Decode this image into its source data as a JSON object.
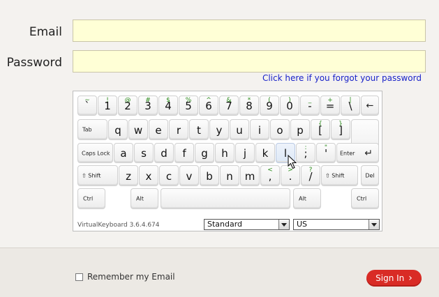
{
  "form": {
    "email_label": "Email",
    "email_value": "",
    "password_label": "Password",
    "password_value": "",
    "forgot_link": "Click here if you forgot your password"
  },
  "keyboard": {
    "version": "VirtualKeyboard 3.6.4.674",
    "layout_select": "Standard",
    "language_select": "US",
    "keys": {
      "backquote": {
        "main": "`",
        "shift": "~"
      },
      "1": {
        "main": "1",
        "shift": "!"
      },
      "2": {
        "main": "2",
        "shift": "@"
      },
      "3": {
        "main": "3",
        "shift": "#"
      },
      "4": {
        "main": "4",
        "shift": "$"
      },
      "5": {
        "main": "5",
        "shift": "%"
      },
      "6": {
        "main": "6",
        "shift": "^"
      },
      "7": {
        "main": "7",
        "shift": "&"
      },
      "8": {
        "main": "8",
        "shift": "*"
      },
      "9": {
        "main": "9",
        "shift": "("
      },
      "0": {
        "main": "0",
        "shift": ")"
      },
      "minus": {
        "main": "-",
        "shift": "_"
      },
      "equal": {
        "main": "=",
        "shift": "+"
      },
      "backslash": {
        "main": "\\",
        "shift": "|"
      },
      "backspace": {
        "main": "←"
      },
      "tab": {
        "main": "Tab"
      },
      "q": {
        "main": "q"
      },
      "w": {
        "main": "w"
      },
      "e": {
        "main": "e"
      },
      "r": {
        "main": "r"
      },
      "t": {
        "main": "t"
      },
      "y": {
        "main": "y"
      },
      "u": {
        "main": "u"
      },
      "i": {
        "main": "i"
      },
      "o": {
        "main": "o"
      },
      "p": {
        "main": "p"
      },
      "lbracket": {
        "main": "[",
        "shift": "{"
      },
      "rbracket": {
        "main": "]",
        "shift": "}"
      },
      "capslock": {
        "main": "Caps Lock"
      },
      "a": {
        "main": "a"
      },
      "s": {
        "main": "s"
      },
      "d": {
        "main": "d"
      },
      "f": {
        "main": "f"
      },
      "g": {
        "main": "g"
      },
      "h": {
        "main": "h"
      },
      "j": {
        "main": "j"
      },
      "k": {
        "main": "k"
      },
      "l": {
        "main": "l"
      },
      "semicolon": {
        "main": ";",
        "shift": ":"
      },
      "quote": {
        "main": "'",
        "shift": "\""
      },
      "enter": {
        "main": "Enter",
        "arrow": "↵"
      },
      "lshift": {
        "main": "⇧ Shift"
      },
      "z": {
        "main": "z"
      },
      "x": {
        "main": "x"
      },
      "c": {
        "main": "c"
      },
      "v": {
        "main": "v"
      },
      "b": {
        "main": "b"
      },
      "n": {
        "main": "n"
      },
      "m": {
        "main": "m"
      },
      "comma": {
        "main": ",",
        "shift": "<"
      },
      "period": {
        "main": ".",
        "shift": ">"
      },
      "slash": {
        "main": "/",
        "shift": "?"
      },
      "rshift": {
        "main": "⇧ Shift"
      },
      "del": {
        "main": "Del"
      },
      "lctrl": {
        "main": "Ctrl"
      },
      "lalt": {
        "main": "Alt"
      },
      "ralt": {
        "main": "Alt"
      },
      "rctrl": {
        "main": "Ctrl"
      }
    }
  },
  "footer": {
    "remember_label": "Remember my Email",
    "remember_checked": false,
    "signin_label": "Sign In",
    "signin_arrow": "›"
  },
  "colors": {
    "input_bg": "#ffffd6",
    "shift_char": "#2a8a1a",
    "link": "#1a23c8",
    "signin": "#d92b25"
  }
}
